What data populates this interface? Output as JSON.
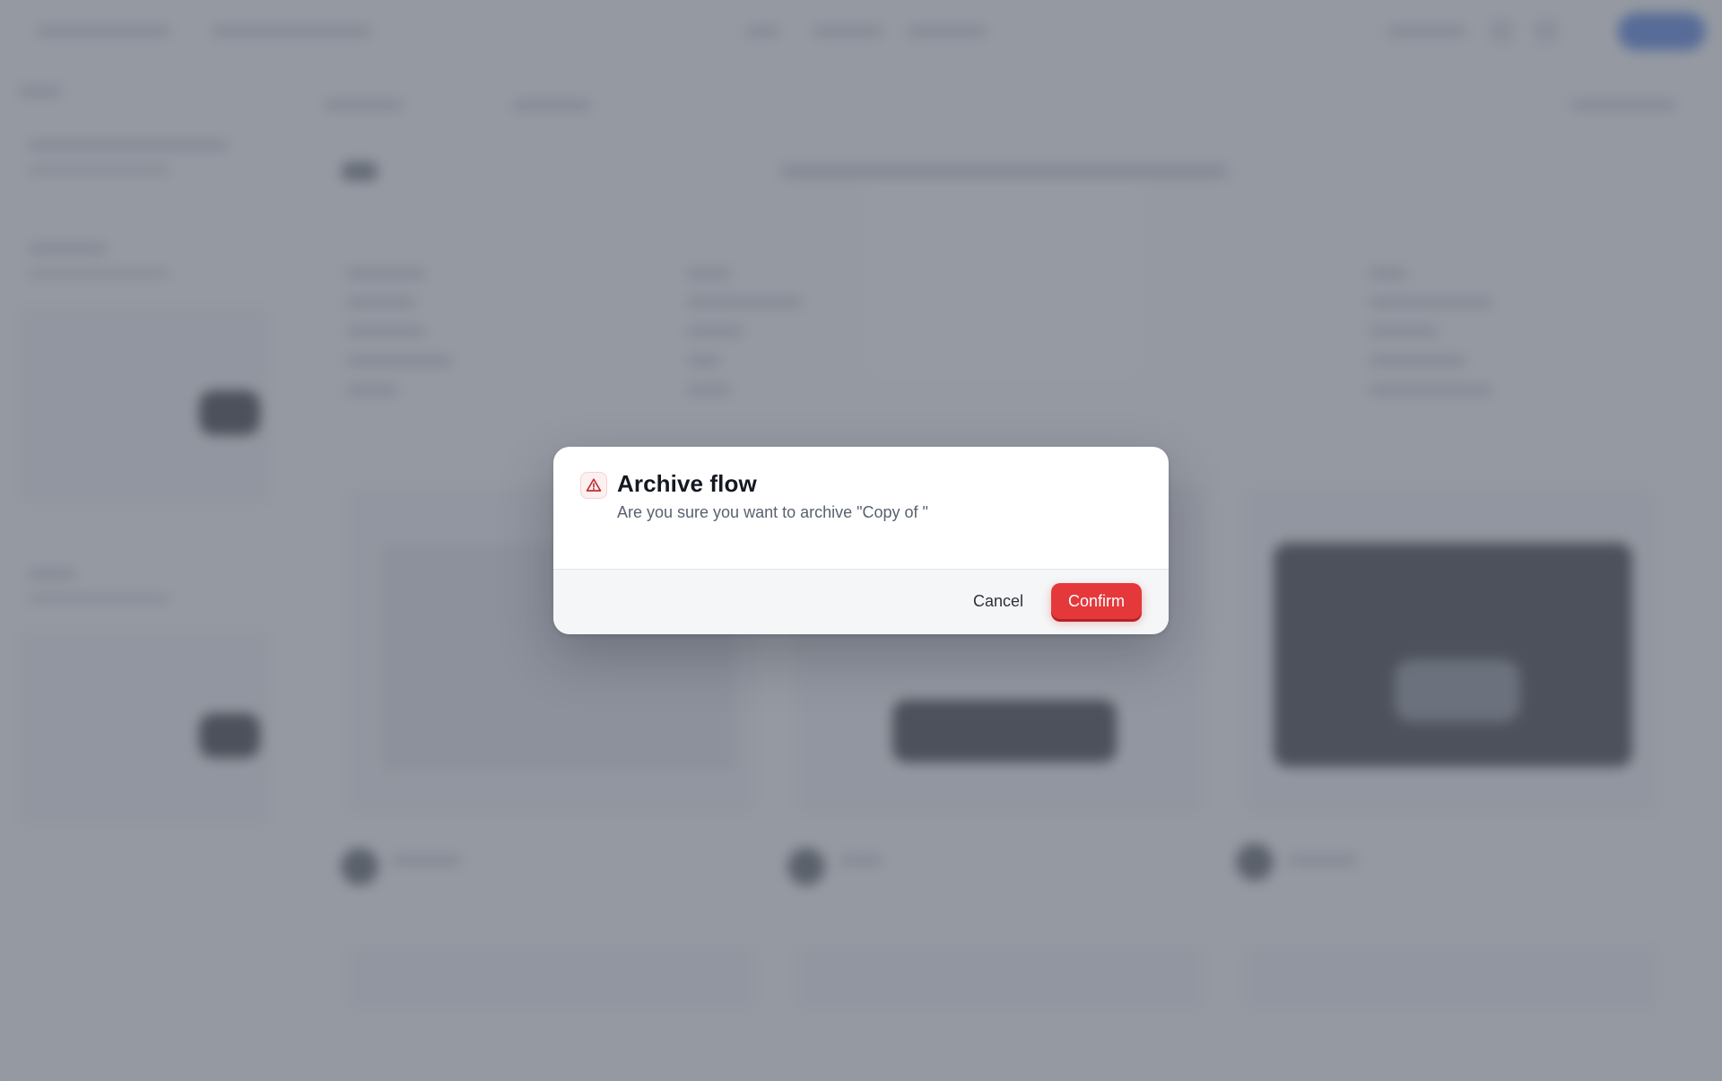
{
  "dialog": {
    "title": "Archive flow",
    "message": "Are you sure you want to archive \"Copy of \"",
    "cancel_label": "Cancel",
    "confirm_label": "Confirm",
    "icon": "warning-triangle-icon"
  },
  "colors": {
    "danger": "#e5383b",
    "overlay": "#646a76",
    "primary": "#3f6fd8"
  }
}
